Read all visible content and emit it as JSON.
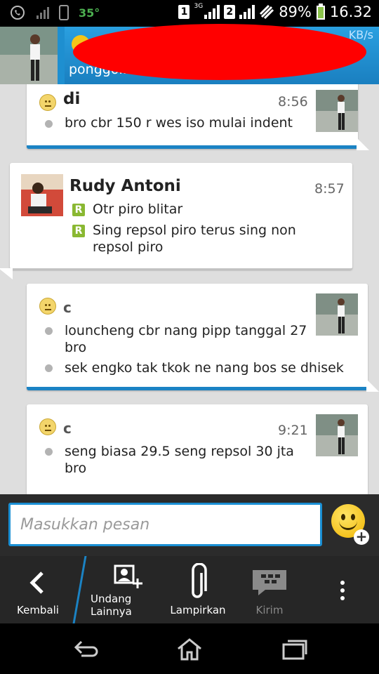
{
  "status_bar": {
    "temperature": "35°",
    "sim1": "1",
    "network": "3G",
    "sim2": "2",
    "battery": "89%",
    "time": "16.32"
  },
  "header": {
    "speed": "KB/s",
    "status_text": "ponggol... ...ar trene..."
  },
  "messages": [
    {
      "sender": "di",
      "time": "8:56",
      "lines": [
        "bro cbr 150 r wes iso mulai indent"
      ]
    },
    {
      "sender": "Rudy Antoni",
      "time": "8:57",
      "lines": [
        "Otr piro blitar",
        "Sing repsol piro terus sing non repsol piro"
      ]
    },
    {
      "sender": "c",
      "time": "",
      "lines": [
        "louncheng cbr nang pipp tanggal 27 bro",
        "sek engko tak tkok ne nang bos se dhisek"
      ]
    },
    {
      "sender": "c",
      "time": "9:21",
      "lines": [
        "seng biasa 29.5 seng repsol 30 jta bro"
      ]
    }
  ],
  "read_badge": "R",
  "composer": {
    "placeholder": "Masukkan pesan"
  },
  "actions": {
    "back": "Kembali",
    "invite": "Undang\nLainnya",
    "attach": "Lampirkan",
    "send": "Kirim"
  },
  "colors": {
    "accent": "#1b83c4",
    "header": "#1e8fd0",
    "read_badge": "#8ab832"
  }
}
